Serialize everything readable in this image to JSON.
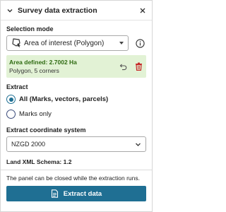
{
  "header": {
    "title": "Survey data extraction",
    "collapse_icon": "chevron-down-icon",
    "close_icon": "close-icon"
  },
  "selection_mode": {
    "label": "Selection mode",
    "value": "Area of interest (Polygon)",
    "icon": "polygon-select-icon",
    "info_icon": "info-icon"
  },
  "area": {
    "defined_text": "Area defined: 2.7002 Ha",
    "detail_text": "Polygon, 5 corners",
    "undo_icon": "undo-icon",
    "delete_icon": "trash-icon"
  },
  "extract": {
    "label": "Extract",
    "options": [
      {
        "label": "All (Marks, vectors, parcels)",
        "selected": true
      },
      {
        "label": "Marks only",
        "selected": false
      }
    ]
  },
  "coordinate_system": {
    "label": "Extract coordinate system",
    "value": "NZGD 2000"
  },
  "schema_text": "Land XML Schema: 1.2",
  "note": "The panel can be closed while the extraction runs.",
  "extract_button": {
    "label": "Extract data",
    "icon": "document-extract-icon"
  },
  "colors": {
    "accent": "#1f6f93",
    "success_bg": "#e2f2d5",
    "success_text": "#2f6b12",
    "danger": "#c62828"
  }
}
